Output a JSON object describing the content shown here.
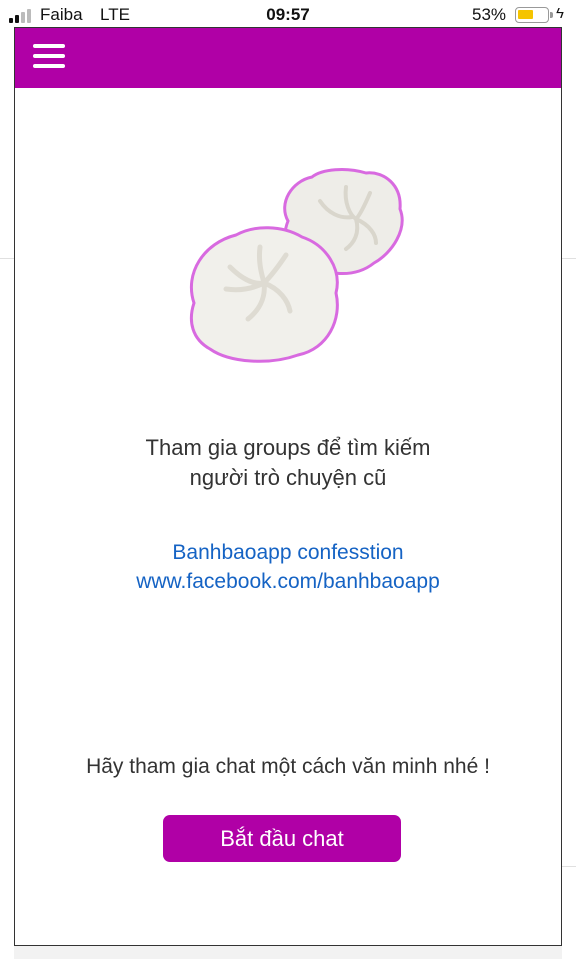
{
  "status_bar": {
    "carrier": "Faiba",
    "network": "LTE",
    "time": "09:57",
    "battery_percent": "53%",
    "battery_level": 0.53,
    "charging_icon": "lightning-icon"
  },
  "header": {
    "menu_icon": "hamburger-menu-icon",
    "color": "#b000a6"
  },
  "illustration": {
    "icon": "bao-buns-image"
  },
  "join_text": {
    "line1": "Tham gia groups để tìm kiếm",
    "line2": "người trò chuyện cũ"
  },
  "links": {
    "confession": "Banhbaoapp confesstion",
    "facebook": "www.facebook.com/banhbaoapp",
    "color": "#1563c4"
  },
  "civil_text": "Hãy tham gia chat một cách văn minh nhé !",
  "start_button": {
    "label": "Bắt đầu chat",
    "color": "#b000a6"
  }
}
